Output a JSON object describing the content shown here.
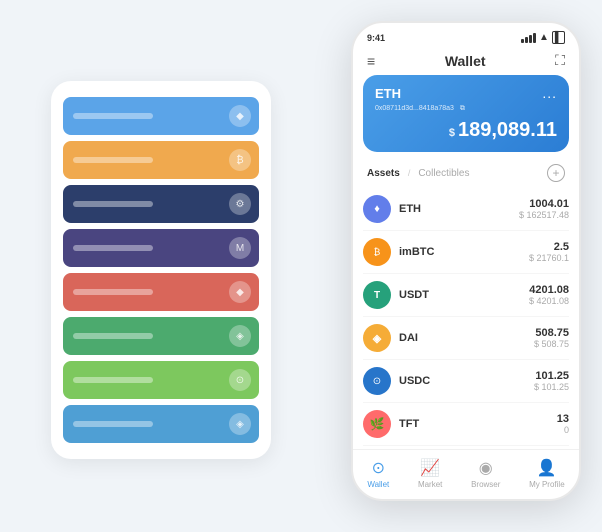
{
  "statusBar": {
    "time": "9:41",
    "signalLabel": "signal",
    "wifiLabel": "wifi",
    "batteryLabel": "battery"
  },
  "nav": {
    "menuIcon": "≡",
    "title": "Wallet",
    "expandIcon": "⛶"
  },
  "ethCard": {
    "title": "ETH",
    "moreIcon": "...",
    "address": "0x08711d3d...8418a78a3",
    "copyIcon": "⧉",
    "currencySymbol": "$",
    "balance": "189,089.11"
  },
  "assetsSection": {
    "activeTab": "Assets",
    "separator": "/",
    "inactiveTab": "Collectibles",
    "addIcon": "+"
  },
  "assets": [
    {
      "name": "ETH",
      "iconText": "♦",
      "iconClass": "eth-icon",
      "amount": "1004.01",
      "usd": "$ 162517.48"
    },
    {
      "name": "imBTC",
      "iconText": "₿",
      "iconClass": "imbtc-icon",
      "amount": "2.5",
      "usd": "$ 21760.1"
    },
    {
      "name": "USDT",
      "iconText": "T",
      "iconClass": "usdt-icon",
      "amount": "4201.08",
      "usd": "$ 4201.08"
    },
    {
      "name": "DAI",
      "iconText": "◈",
      "iconClass": "dai-icon",
      "amount": "508.75",
      "usd": "$ 508.75"
    },
    {
      "name": "USDC",
      "iconText": "⊙",
      "iconClass": "usdc-icon",
      "amount": "101.25",
      "usd": "$ 101.25"
    },
    {
      "name": "TFT",
      "iconText": "🌿",
      "iconClass": "tft-icon",
      "amount": "13",
      "usd": "0"
    }
  ],
  "bottomNav": [
    {
      "id": "wallet",
      "icon": "⊙",
      "label": "Wallet",
      "active": true
    },
    {
      "id": "market",
      "icon": "📈",
      "label": "Market",
      "active": false
    },
    {
      "id": "browser",
      "icon": "◉",
      "label": "Browser",
      "active": false
    },
    {
      "id": "profile",
      "icon": "👤",
      "label": "My Profile",
      "active": false
    }
  ],
  "cardStack": [
    {
      "color": "c1"
    },
    {
      "color": "c2"
    },
    {
      "color": "c3"
    },
    {
      "color": "c4"
    },
    {
      "color": "c5"
    },
    {
      "color": "c6"
    },
    {
      "color": "c7"
    },
    {
      "color": "c8"
    }
  ]
}
